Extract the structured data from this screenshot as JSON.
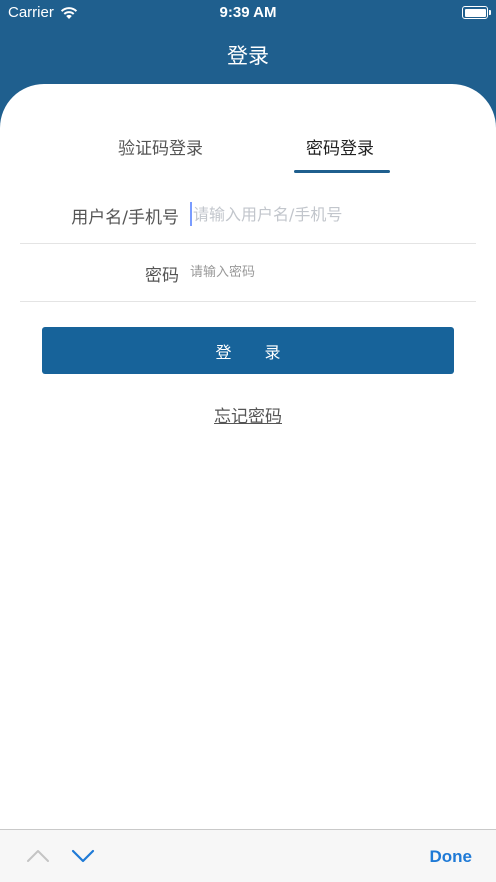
{
  "status_bar": {
    "carrier": "Carrier",
    "time": "9:39 AM",
    "wifi_icon": "wifi-icon",
    "battery_icon": "battery-full-icon"
  },
  "nav": {
    "title": "登录"
  },
  "tabs": [
    {
      "label": "验证码登录",
      "active": false
    },
    {
      "label": "密码登录",
      "active": true
    }
  ],
  "form": {
    "username": {
      "label": "用户名/手机号",
      "placeholder": "请输入用户名/手机号",
      "value": ""
    },
    "password": {
      "label": "密码",
      "placeholder": "请输入密码",
      "value": ""
    },
    "login_button": "登 录",
    "forgot_link": "忘记密码"
  },
  "keyboard_toolbar": {
    "prev_icon": "chevron-up-icon",
    "next_icon": "chevron-down-icon",
    "done_label": "Done"
  },
  "colors": {
    "brand": "#1f5f8e",
    "button": "#17639a",
    "done": "#1f7ad6"
  }
}
